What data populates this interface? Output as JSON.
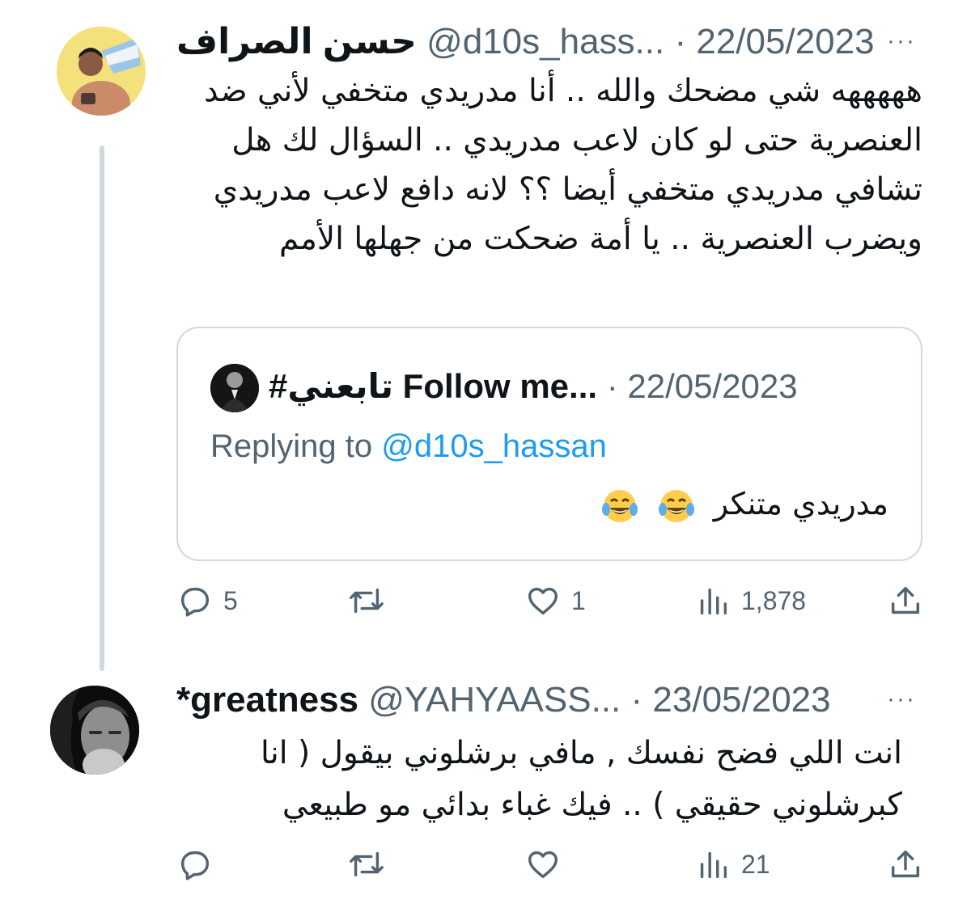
{
  "tweet1": {
    "display_name": "حسن الصراف",
    "handle": "@d10s_hass...",
    "separator": "·",
    "date": "22/05/2023",
    "more_label": "···",
    "text": "هههههه شي مضحك والله .. أنا مدريدي متخفي لأني ضد العنصرية حتى لو كان لاعب مدريدي .. السؤال لك هل تشافي مدريدي متخفي أيضا ؟؟ لانه دافع لاعب مدريدي ويضرب العنصرية .. يا أمة ضحكت من جهلها الأمم",
    "quote": {
      "display_name": "#تابعني Follow me...",
      "separator": "·",
      "date": "22/05/2023",
      "replying_prefix": "Replying to",
      "replying_handle": "@d10s_hassan",
      "text": "مدريدي متنكر",
      "emoji": "face-with-tears-of-joy"
    },
    "actions": {
      "replies": "5",
      "retweets": "",
      "likes": "1",
      "views": "1,878"
    }
  },
  "tweet2": {
    "display_name": "*greatness",
    "handle": "@YAHYAASS...",
    "separator": "·",
    "date": "23/05/2023",
    "more_label": "···",
    "text": "انت اللي فضح نفسك , مافي برشلوني بيقول ( انا كبرشلوني حقيقي ) .. فيك غباء بدائي مو طبيعي",
    "actions": {
      "replies": "",
      "retweets": "",
      "likes": "",
      "views": "21"
    }
  },
  "icons": {
    "reply": "speech-bubble-icon",
    "retweet": "retweet-arrows-icon",
    "like": "heart-icon",
    "views": "bar-chart-icon",
    "share": "share-upload-icon"
  },
  "colors": {
    "text_primary": "#0f1419",
    "text_secondary": "#536471",
    "link": "#1d9bf0",
    "border": "#cfd9de"
  }
}
